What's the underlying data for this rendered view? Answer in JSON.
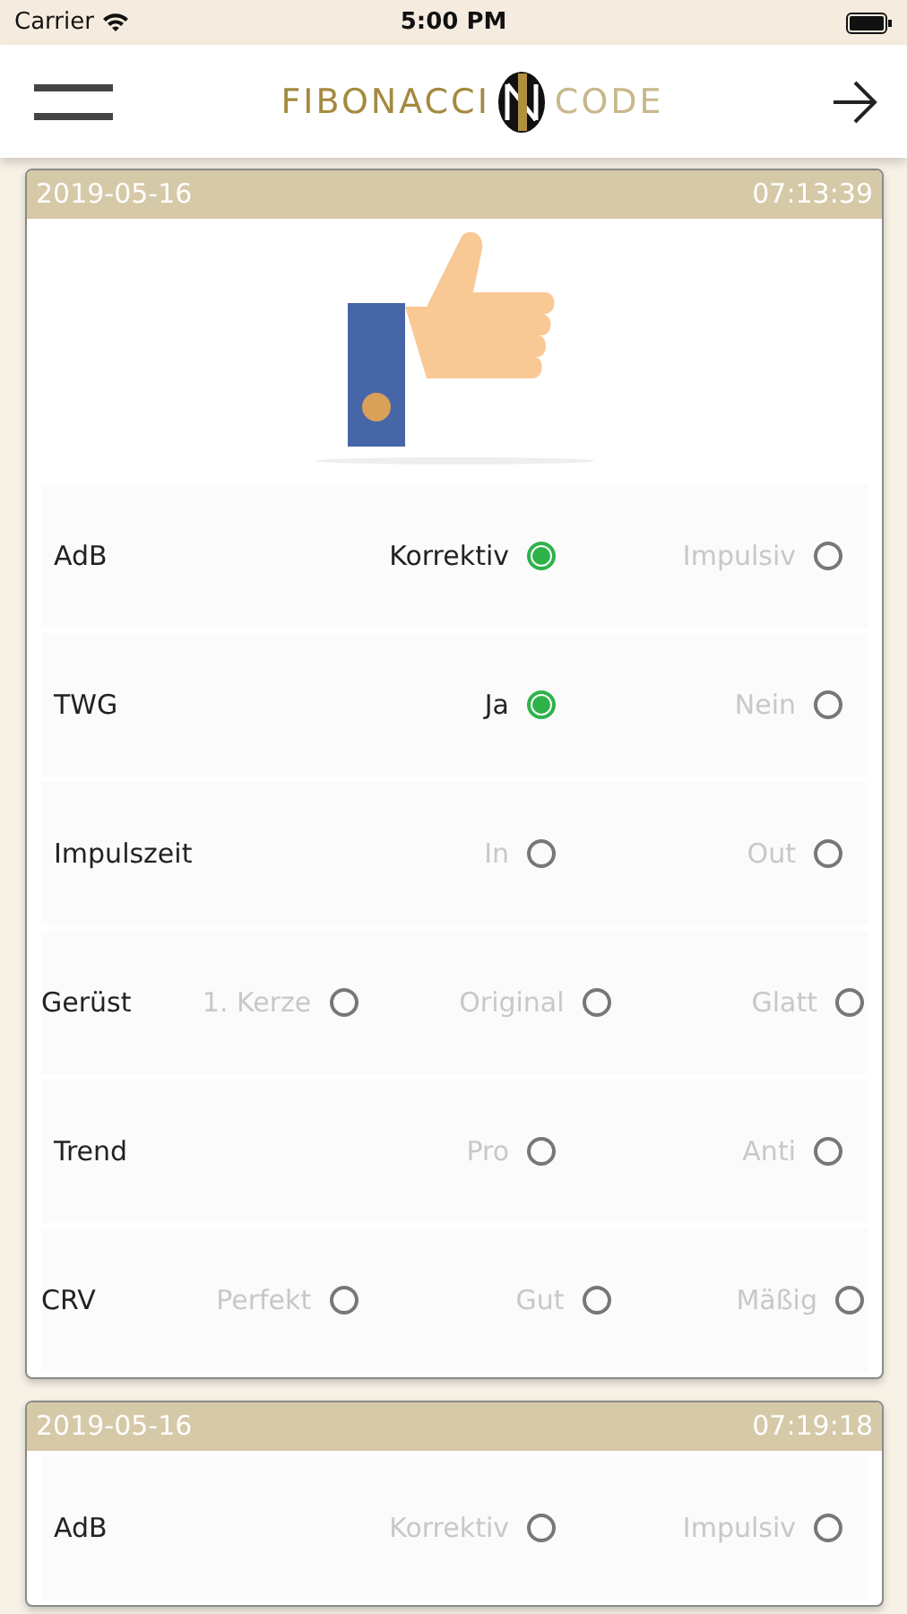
{
  "status_bar": {
    "carrier": "Carrier",
    "time": "5:00 PM"
  },
  "nav": {
    "logo_left": "FIBONACCI",
    "logo_right": "CODE"
  },
  "entries": [
    {
      "date": "2019-05-16",
      "time": "07:13:39",
      "rating_image": true,
      "rows": [
        {
          "label": "AdB",
          "options": [
            {
              "label": "Korrektiv",
              "selected": true
            },
            {
              "label": "Impulsiv",
              "selected": false
            }
          ]
        },
        {
          "label": "TWG",
          "options": [
            {
              "label": "Ja",
              "selected": true
            },
            {
              "label": "Nein",
              "selected": false
            }
          ]
        },
        {
          "label": "Impulszeit",
          "options": [
            {
              "label": "In",
              "selected": false
            },
            {
              "label": "Out",
              "selected": false
            }
          ]
        },
        {
          "label": "Gerüst",
          "options": [
            {
              "label": "1. Kerze",
              "selected": false
            },
            {
              "label": "Original",
              "selected": false
            },
            {
              "label": "Glatt",
              "selected": false
            }
          ]
        },
        {
          "label": "Trend",
          "options": [
            {
              "label": "Pro",
              "selected": false
            },
            {
              "label": "Anti",
              "selected": false
            }
          ]
        },
        {
          "label": "CRV",
          "options": [
            {
              "label": "Perfekt",
              "selected": false
            },
            {
              "label": "Gut",
              "selected": false
            },
            {
              "label": "Mäßig",
              "selected": false
            }
          ]
        }
      ]
    },
    {
      "date": "2019-05-16",
      "time": "07:19:18",
      "rating_image": false,
      "rows": [
        {
          "label": "AdB",
          "options": [
            {
              "label": "Korrektiv",
              "selected": false
            },
            {
              "label": "Impulsiv",
              "selected": false
            }
          ]
        }
      ]
    }
  ]
}
